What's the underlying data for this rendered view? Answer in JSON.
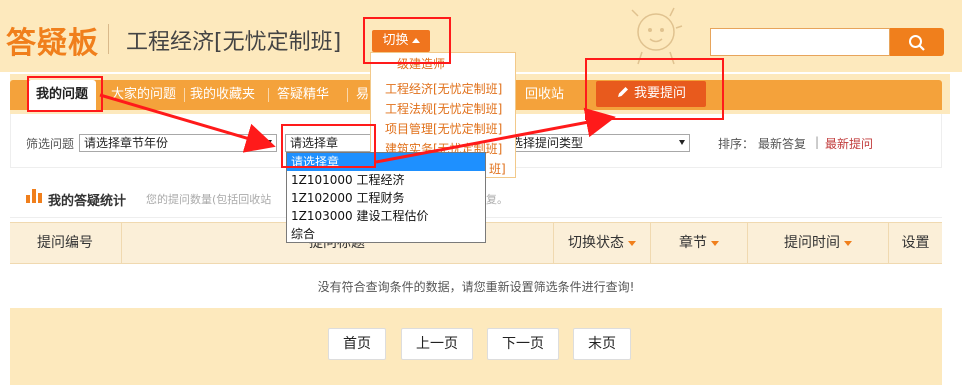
{
  "header": {
    "logo": "答疑板",
    "course_title": "工程经济[无忧定制班]",
    "switch_label": "切换",
    "search_placeholder": ""
  },
  "switch_menu": {
    "items": [
      "一级建造师",
      "工程经济[无忧定制班]",
      "工程法规[无忧定制班]",
      "项目管理[无忧定制班]",
      "建筑实务[无忧定制班]",
      "班]"
    ]
  },
  "nav": {
    "items": [
      "我的问题",
      "大家的问题",
      "我的收藏夹",
      "答疑精华",
      "易",
      "回收站"
    ],
    "ask_button": "我要提问"
  },
  "filter": {
    "label": "筛选问题",
    "year_select": "请选择章节年份",
    "chapter_select": "请选择章",
    "type_select": "选择提问类型",
    "sort_label": "排序：",
    "sort_latest_answer": "最新答复",
    "sort_sep": "|",
    "sort_latest_question": "最新提问"
  },
  "chapter_menu": {
    "options": [
      "请选择章",
      "1Z101000 工程经济",
      "1Z102000 工程财务",
      "1Z103000 建设工程估价",
      "综合"
    ],
    "selected_index": 0
  },
  "stats": {
    "title": "我的答疑统计",
    "desc": "您的提问数量(包括回收站",
    "desc_tail": "复。"
  },
  "table": {
    "headers": [
      "提问编号",
      "提问标题",
      "切换状态",
      "章节",
      "提问时间",
      "设置"
    ],
    "empty_message": "没有符合查询条件的数据，请您重新设置筛选条件进行查询!"
  },
  "pager": {
    "first": "首页",
    "prev": "上一页",
    "next": "下一页",
    "last": "末页"
  },
  "colors": {
    "accent": "#f07f1c",
    "nav_bar": "#f4a23b",
    "ask_button": "#e85a1d",
    "header_bg": "#fde9bd",
    "annotation": "#ff1a1a"
  }
}
